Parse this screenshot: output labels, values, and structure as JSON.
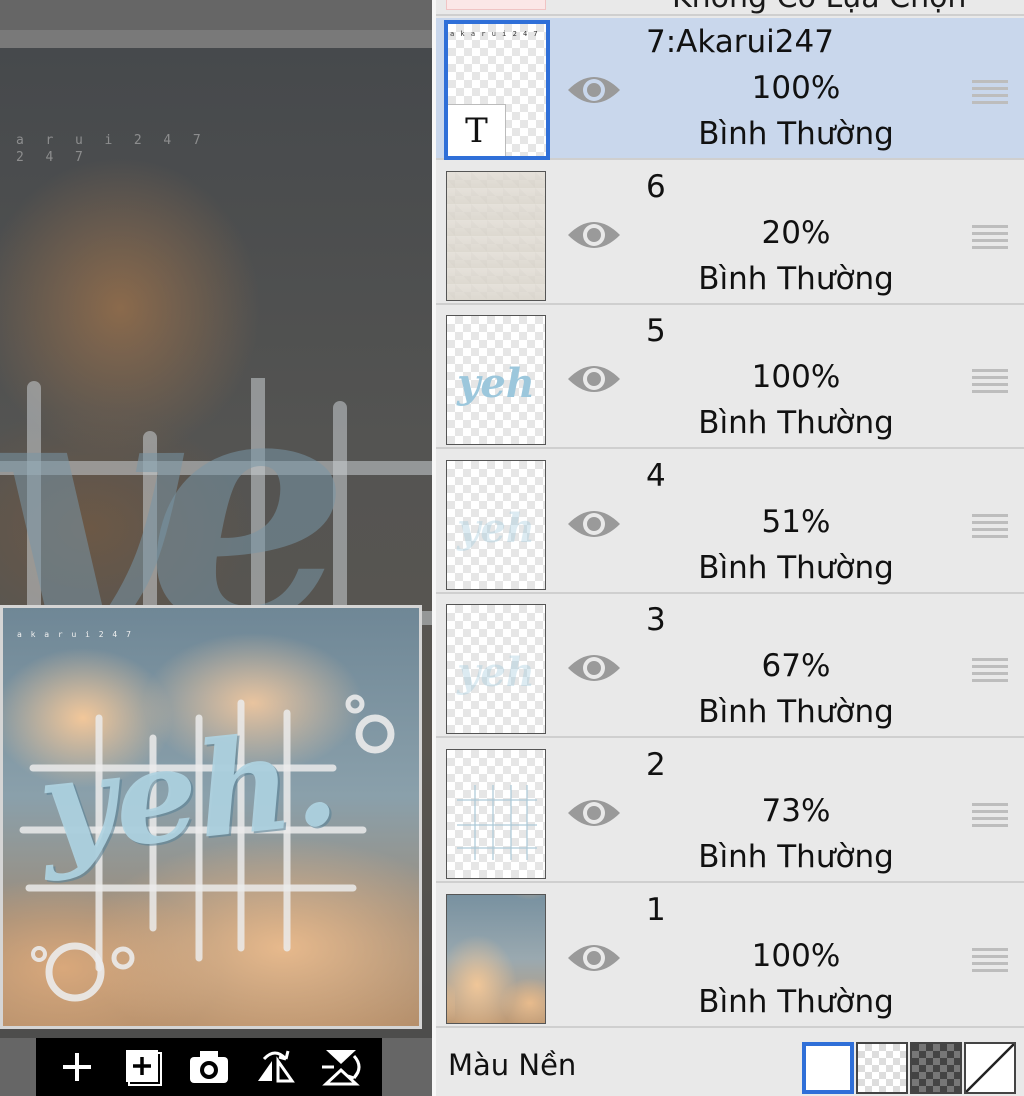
{
  "canvas": {
    "watermark_line1": "a  r  u  i  2  4  7",
    "watermark_line2": "2  4  7",
    "ghost_text": "ye",
    "preview_watermark": "a k a r u i 2 4 7",
    "preview_text": "yeh."
  },
  "toolbar": {
    "buttons": [
      {
        "icon": "plus-icon",
        "label": "+"
      },
      {
        "icon": "add-layer-icon",
        "label": "+"
      },
      {
        "icon": "camera-icon",
        "label": ""
      },
      {
        "icon": "flip-horizontal-icon",
        "label": ""
      },
      {
        "icon": "flip-vertical-icon",
        "label": ""
      }
    ]
  },
  "layers_panel": {
    "header_label": "Không Có Lựa Chọn",
    "layers": [
      {
        "name": "7:Akarui247",
        "opacity": "100%",
        "blend": "Bình Thường",
        "selected": true,
        "thumb": "text"
      },
      {
        "name": "6",
        "opacity": "20%",
        "blend": "Bình Thường",
        "selected": false,
        "thumb": "texture"
      },
      {
        "name": "5",
        "opacity": "100%",
        "blend": "Bình Thường",
        "selected": false,
        "thumb": "yeh",
        "thumb_text": "yeh"
      },
      {
        "name": "4",
        "opacity": "51%",
        "blend": "Bình Thường",
        "selected": false,
        "thumb": "yeh-faint",
        "thumb_text": "yeh"
      },
      {
        "name": "3",
        "opacity": "67%",
        "blend": "Bình Thường",
        "selected": false,
        "thumb": "yeh-faint",
        "thumb_text": "yeh"
      },
      {
        "name": "2",
        "opacity": "73%",
        "blend": "Bình Thường",
        "selected": false,
        "thumb": "grid"
      },
      {
        "name": "1",
        "opacity": "100%",
        "blend": "Bình Thường",
        "selected": false,
        "thumb": "photo"
      }
    ],
    "background": {
      "label": "Màu Nền",
      "options": [
        "white",
        "transparent",
        "dark-checker",
        "none"
      ],
      "selected": "white"
    }
  },
  "colors": {
    "selection_blue": "#2f6fd8",
    "selected_row": "#c9d7ec",
    "panel_bg": "#e9e9e9"
  }
}
